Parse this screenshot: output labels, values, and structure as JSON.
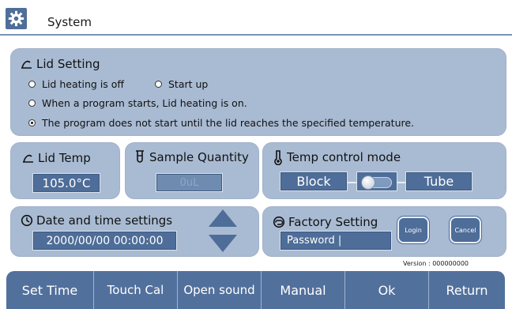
{
  "header": {
    "title": "System",
    "icon": "gear-icon"
  },
  "lid_setting": {
    "title": "Lid Setting",
    "icon": "lid-icon",
    "options": [
      {
        "label": "Lid heating is off",
        "selected": false
      },
      {
        "label": "Start up",
        "selected": false
      },
      {
        "label": "When a program starts, Lid heating is on.",
        "selected": false
      },
      {
        "label": "The program does not start until the lid reaches the specified temperature.",
        "selected": true
      }
    ]
  },
  "lid_temp": {
    "title": "Lid Temp",
    "icon": "lid-icon",
    "value": "105.0°C"
  },
  "sample_quantity": {
    "title": "Sample Quantity",
    "icon": "tube-icon",
    "value": "0uL"
  },
  "temp_control": {
    "title": "Temp control mode",
    "icon": "thermometer-icon",
    "left_label": "Block",
    "right_label": "Tube",
    "toggle_position": "left"
  },
  "datetime": {
    "title": "Date and time settings",
    "icon": "clock-icon",
    "value": "2000/00/00 00:00:00"
  },
  "factory": {
    "title": "Factory Setting",
    "icon": "back-arrow-icon",
    "password_placeholder": "Password  |",
    "login_label": "Login",
    "cancel_label": "Cancel"
  },
  "version": "Version : 000000000",
  "bottom_bar": {
    "buttons": [
      "Set Time",
      "Touch Cal",
      "Open sound",
      "Manual",
      "Ok",
      "Return"
    ]
  },
  "colors": {
    "panel": "#a9bbd3",
    "field": "#4e6d98",
    "bottom_bar": "#52709c",
    "title_rule": "#7a93b6"
  }
}
